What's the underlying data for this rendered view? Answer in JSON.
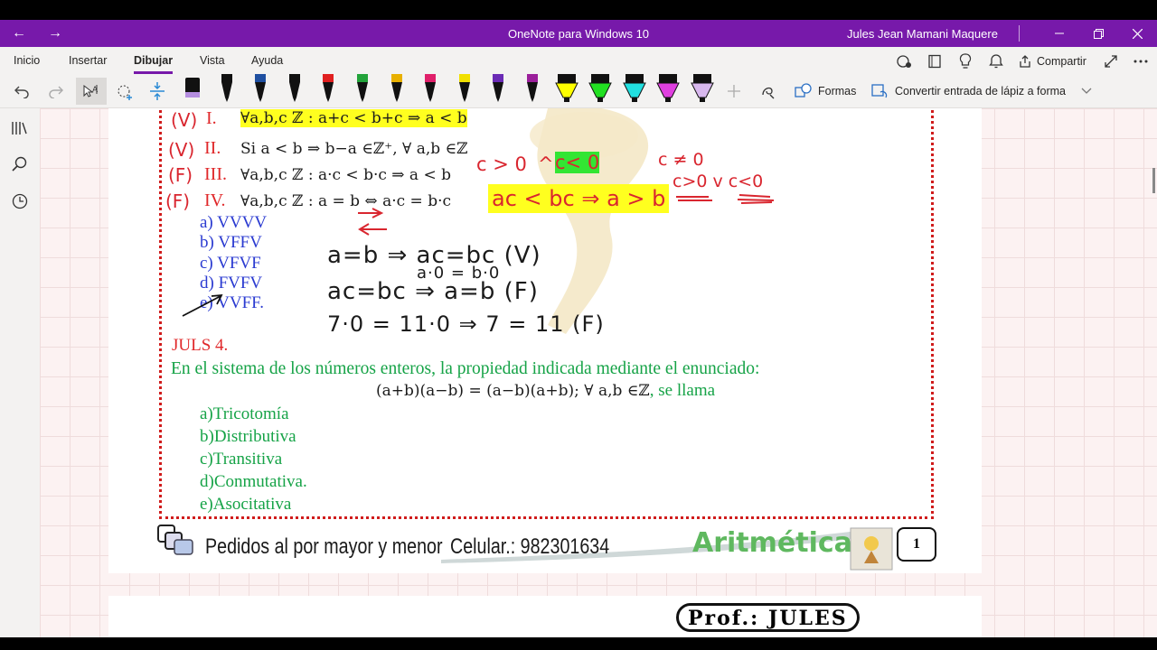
{
  "window": {
    "title": "OneNote para Windows 10",
    "user": "Jules Jean Mamani Maquere",
    "accent_color": "#7719aa"
  },
  "menu": {
    "tabs": [
      "Inicio",
      "Insertar",
      "Dibujar",
      "Vista",
      "Ayuda"
    ],
    "active_tab": "Dibujar",
    "share_label": "Compartir"
  },
  "toolbar": {
    "formas_label": "Formas",
    "convert_label": "Convertir entrada de lápiz a forma",
    "pen_colors": [
      "#111111",
      "#111111",
      "#1f4fa0",
      "#111111",
      "#e02020",
      "#22a33a",
      "#e8b000",
      "#e0206a",
      "#f1e000",
      "#6a2bb5",
      "#9b1f9b",
      "#ffff00",
      "#22e022",
      "#22e0e0",
      "#e040e0",
      "#d8b8ee"
    ]
  },
  "document": {
    "items": [
      {
        "mark": "(V)",
        "num": "I.",
        "expr": "∀a,b,c ℤ : a+c < b+c ⇒ a < b"
      },
      {
        "mark": "(V)",
        "num": "II.",
        "expr": "Si a < b ⇒ b−a ∈ℤ⁺,  ∀ a,b ∈ℤ"
      },
      {
        "mark": "(F)",
        "num": "III.",
        "expr": "∀a,b,c ℤ : a·c < b·c ⇒ a < b"
      },
      {
        "mark": "(F)",
        "num": "IV.",
        "expr": "∀a,b,c ℤ : a = b ⇔ a·c = b·c"
      }
    ],
    "options": [
      "a) VVVV",
      "b) VFFV",
      "c) VFVF",
      "d) FVFV",
      "e) VVFF."
    ],
    "handwriting": {
      "cond1": "c > 0",
      "caret": "^",
      "cond2": "c< 0",
      "ineq": "ac < bc ⇒ a > b",
      "c_ne": "c ≠ 0",
      "c_gt_lt": "c>0 v c<0",
      "line1": "a=b ⇒ ac=bc (V)",
      "line1b": "a·0 = b·0",
      "line2": "ac=bc ⇒ a=b (F)",
      "line3": "7·0 = 11·0 ⇒ 7 = 11 (F)"
    },
    "problem": {
      "label": "JULS 4.",
      "statement": "En el sistema de los números enteros, la propiedad indicada mediante el enunciado:",
      "equation": "(a+b)(a−b) = (a−b)(a+b);   ∀ a,b ∈ℤ",
      "equation_suffix": ", se llama",
      "choices": [
        "a)Tricotomía",
        "b)Distributiva",
        "c)Transitiva",
        "d)Conmutativa.",
        "e)Asocitativa"
      ]
    },
    "footer": {
      "wholesale": "Pedidos al por mayor y menor",
      "phone": "Celular.: 982301634",
      "subject": "Aritmética",
      "page_number": "1"
    },
    "next_page_header": "Prof.: JULES"
  }
}
